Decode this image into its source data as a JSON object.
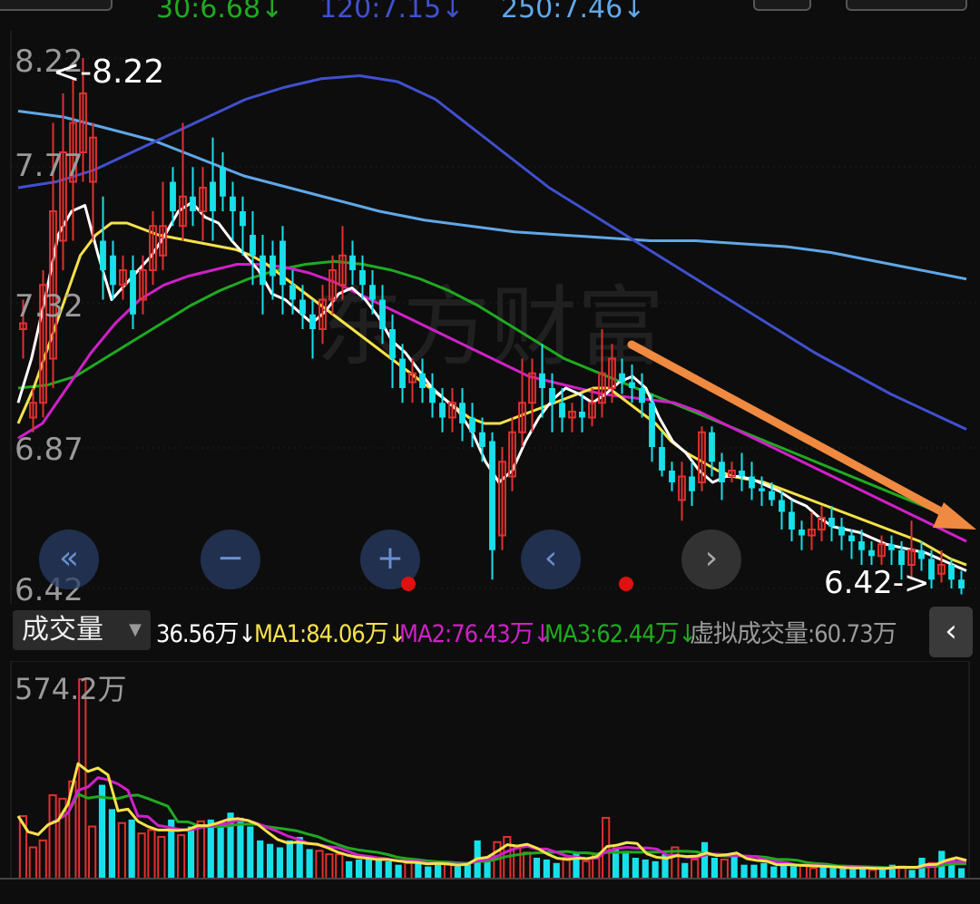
{
  "top_ma": [
    {
      "label": "30:6.68↓",
      "color": "#1faa1f"
    },
    {
      "label": "120:7.15↓",
      "color": "#4050d0"
    },
    {
      "label": "250:7.46↓",
      "color": "#60a8e8"
    }
  ],
  "price_axis": {
    "labels": [
      "8.22",
      "7.77",
      "7.32",
      "6.87",
      "6.42"
    ]
  },
  "annotations": {
    "high_marker": "<-8.22",
    "low_marker": "6.42->"
  },
  "watermark": "东方财富",
  "volume_header": {
    "selector_label": "成交量",
    "current": "36.56万↓",
    "ma1": "MA1:84.06万↓",
    "ma2": "MA2:76.43万↓",
    "ma3": "MA3:62.44万↓",
    "virtual": "虚拟成交量:60.73万"
  },
  "volume_axis": {
    "max_label": "574.2万"
  },
  "colors": {
    "up": "#e03030",
    "down": "#18e0ea",
    "ma5": "#ffffff",
    "ma10": "#f5e24a",
    "ma20": "#d020c8",
    "ma30": "#1faa1f",
    "ma120": "#4050d0",
    "ma250": "#60a8e8",
    "arrow": "#f08a40"
  },
  "nav_buttons": {
    "rewind": "«",
    "zoom_out": "−",
    "zoom_in": "+",
    "prev": "‹",
    "next": "›",
    "collapse": "‹"
  },
  "chart_data": {
    "type": "candlestick",
    "y_range": [
      6.42,
      8.22
    ],
    "candles": [
      [
        7.3,
        7.32,
        7.2,
        7.4
      ],
      [
        7.0,
        7.05,
        6.95,
        7.1
      ],
      [
        7.05,
        7.45,
        7.0,
        7.5
      ],
      [
        7.2,
        7.7,
        7.1,
        8.0
      ],
      [
        7.6,
        7.9,
        7.5,
        8.1
      ],
      [
        7.8,
        8.0,
        7.6,
        8.15
      ],
      [
        7.9,
        8.1,
        7.8,
        8.22
      ],
      [
        7.8,
        7.95,
        7.6,
        8.0
      ],
      [
        7.6,
        7.5,
        7.4,
        7.75
      ],
      [
        7.55,
        7.45,
        7.4,
        7.6
      ],
      [
        7.45,
        7.5,
        7.4,
        7.55
      ],
      [
        7.5,
        7.35,
        7.3,
        7.55
      ],
      [
        7.4,
        7.5,
        7.35,
        7.55
      ],
      [
        7.5,
        7.65,
        7.45,
        7.7
      ],
      [
        7.55,
        7.65,
        7.5,
        7.8
      ],
      [
        7.8,
        7.7,
        7.65,
        7.85
      ],
      [
        7.65,
        7.75,
        7.6,
        8.0
      ],
      [
        7.75,
        7.7,
        7.65,
        7.85
      ],
      [
        7.7,
        7.78,
        7.6,
        7.85
      ],
      [
        7.8,
        7.7,
        7.6,
        7.95
      ],
      [
        7.85,
        7.75,
        7.7,
        7.9
      ],
      [
        7.75,
        7.7,
        7.6,
        7.8
      ],
      [
        7.7,
        7.65,
        7.55,
        7.75
      ],
      [
        7.62,
        7.55,
        7.45,
        7.7
      ],
      [
        7.55,
        7.45,
        7.35,
        7.62
      ],
      [
        7.55,
        7.48,
        7.4,
        7.6
      ],
      [
        7.6,
        7.45,
        7.35,
        7.65
      ],
      [
        7.45,
        7.4,
        7.35,
        7.5
      ],
      [
        7.4,
        7.35,
        7.3,
        7.45
      ],
      [
        7.35,
        7.3,
        7.2,
        7.4
      ],
      [
        7.3,
        7.4,
        7.25,
        7.45
      ],
      [
        7.4,
        7.5,
        7.35,
        7.55
      ],
      [
        7.45,
        7.55,
        7.4,
        7.65
      ],
      [
        7.55,
        7.5,
        7.45,
        7.6
      ],
      [
        7.5,
        7.45,
        7.4,
        7.55
      ],
      [
        7.45,
        7.4,
        7.35,
        7.5
      ],
      [
        7.4,
        7.3,
        7.25,
        7.45
      ],
      [
        7.3,
        7.2,
        7.1,
        7.35
      ],
      [
        7.2,
        7.1,
        7.05,
        7.25
      ],
      [
        7.12,
        7.15,
        7.05,
        7.2
      ],
      [
        7.15,
        7.1,
        7.05,
        7.2
      ],
      [
        7.1,
        7.05,
        7.0,
        7.15
      ],
      [
        7.05,
        7.0,
        6.95,
        7.1
      ],
      [
        7.0,
        7.05,
        6.95,
        7.1
      ],
      [
        7.05,
        6.98,
        6.92,
        7.1
      ],
      [
        7.0,
        6.95,
        6.9,
        7.05
      ],
      [
        6.95,
        6.9,
        6.85,
        7.0
      ],
      [
        6.92,
        6.55,
        6.45,
        6.95
      ],
      [
        6.6,
        6.85,
        6.55,
        6.9
      ],
      [
        6.8,
        6.95,
        6.75,
        7.0
      ],
      [
        6.95,
        7.05,
        6.9,
        7.2
      ],
      [
        7.05,
        7.15,
        6.95,
        7.2
      ],
      [
        7.15,
        7.1,
        7.0,
        7.25
      ],
      [
        7.1,
        7.05,
        6.95,
        7.15
      ],
      [
        7.05,
        7.0,
        6.95,
        7.1
      ],
      [
        7.0,
        7.02,
        6.95,
        7.05
      ],
      [
        7.02,
        7.0,
        6.95,
        7.08
      ],
      [
        7.0,
        7.05,
        6.97,
        7.1
      ],
      [
        7.05,
        7.15,
        7.0,
        7.3
      ],
      [
        7.1,
        7.2,
        7.05,
        7.25
      ],
      [
        7.15,
        7.12,
        7.08,
        7.2
      ],
      [
        7.12,
        7.1,
        7.05,
        7.18
      ],
      [
        7.1,
        7.05,
        7.0,
        7.15
      ],
      [
        7.05,
        6.9,
        6.85,
        7.08
      ],
      [
        6.9,
        6.82,
        6.8,
        6.95
      ],
      [
        6.82,
        6.78,
        6.75,
        6.85
      ],
      [
        6.72,
        6.8,
        6.65,
        6.85
      ],
      [
        6.8,
        6.75,
        6.7,
        6.85
      ],
      [
        6.78,
        6.95,
        6.75,
        6.97
      ],
      [
        6.95,
        6.85,
        6.8,
        6.97
      ],
      [
        6.85,
        6.78,
        6.72,
        6.88
      ],
      [
        6.8,
        6.82,
        6.78,
        6.85
      ],
      [
        6.82,
        6.8,
        6.75,
        6.88
      ],
      [
        6.8,
        6.76,
        6.72,
        6.85
      ],
      [
        6.76,
        6.75,
        6.7,
        6.8
      ],
      [
        6.75,
        6.72,
        6.7,
        6.78
      ],
      [
        6.72,
        6.68,
        6.62,
        6.75
      ],
      [
        6.68,
        6.62,
        6.58,
        6.72
      ],
      [
        6.62,
        6.6,
        6.55,
        6.65
      ],
      [
        6.6,
        6.62,
        6.55,
        6.68
      ],
      [
        6.62,
        6.66,
        6.58,
        6.7
      ],
      [
        6.66,
        6.63,
        6.58,
        6.7
      ],
      [
        6.63,
        6.6,
        6.55,
        6.66
      ],
      [
        6.6,
        6.58,
        6.52,
        6.62
      ],
      [
        6.58,
        6.55,
        6.5,
        6.62
      ],
      [
        6.55,
        6.53,
        6.5,
        6.58
      ],
      [
        6.53,
        6.57,
        6.5,
        6.6
      ],
      [
        6.57,
        6.55,
        6.5,
        6.6
      ],
      [
        6.55,
        6.5,
        6.45,
        6.58
      ],
      [
        6.5,
        6.55,
        6.45,
        6.65
      ],
      [
        6.55,
        6.52,
        6.48,
        6.58
      ],
      [
        6.52,
        6.45,
        6.42,
        6.55
      ],
      [
        6.47,
        6.5,
        6.44,
        6.55
      ],
      [
        6.5,
        6.45,
        6.42,
        6.52
      ],
      [
        6.45,
        6.42,
        6.4,
        6.48
      ]
    ],
    "ma5": [
      7.05,
      7.2,
      7.4,
      7.62,
      7.7,
      7.72,
      7.55,
      7.4,
      7.45,
      7.5,
      7.55,
      7.62,
      7.7,
      7.73,
      7.68,
      7.66,
      7.6,
      7.55,
      7.5,
      7.42,
      7.4,
      7.36,
      7.32,
      7.36,
      7.42,
      7.44,
      7.4,
      7.34,
      7.26,
      7.22,
      7.16,
      7.1,
      7.06,
      7.02,
      6.95,
      6.85,
      6.78,
      6.82,
      6.92,
      7.0,
      7.06,
      7.1,
      7.08,
      7.05,
      7.08,
      7.12,
      7.14,
      7.1,
      7.0,
      6.92,
      6.88,
      6.82,
      6.78,
      6.8,
      6.8,
      6.79,
      6.77,
      6.75,
      6.72,
      6.7,
      6.66,
      6.63,
      6.62,
      6.61,
      6.59,
      6.57,
      6.56,
      6.55,
      6.54,
      6.52,
      6.5,
      6.48
    ],
    "ma10": [
      6.98,
      7.1,
      7.25,
      7.4,
      7.55,
      7.62,
      7.66,
      7.66,
      7.64,
      7.62,
      7.61,
      7.6,
      7.59,
      7.58,
      7.57,
      7.55,
      7.52,
      7.48,
      7.44,
      7.4,
      7.36,
      7.32,
      7.28,
      7.24,
      7.2,
      7.16,
      7.12,
      7.08,
      7.04,
      7.0,
      6.98,
      6.98,
      7.0,
      7.02,
      7.04,
      7.06,
      7.08,
      7.1,
      7.1,
      7.06,
      7.02,
      6.98,
      6.92,
      6.88,
      6.85,
      6.82,
      6.8,
      6.79,
      6.78,
      6.76,
      6.74,
      6.72,
      6.7,
      6.68,
      6.66,
      6.64,
      6.62,
      6.6,
      6.58,
      6.55,
      6.52,
      6.5
    ],
    "ma20": [
      6.93,
      6.98,
      7.1,
      7.22,
      7.32,
      7.4,
      7.45,
      7.48,
      7.5,
      7.52,
      7.52,
      7.51,
      7.49,
      7.46,
      7.42,
      7.38,
      7.34,
      7.3,
      7.26,
      7.22,
      7.18,
      7.14,
      7.12,
      7.1,
      7.08,
      7.07,
      7.06,
      7.05,
      7.02,
      6.98,
      6.94,
      6.9,
      6.86,
      6.82,
      6.78,
      6.74,
      6.7,
      6.66,
      6.62,
      6.58
    ],
    "ma30": [
      7.1,
      7.11,
      7.14,
      7.2,
      7.26,
      7.32,
      7.38,
      7.43,
      7.47,
      7.5,
      7.52,
      7.53,
      7.52,
      7.5,
      7.47,
      7.43,
      7.38,
      7.32,
      7.26,
      7.2,
      7.16,
      7.12,
      7.08,
      7.04,
      7.0,
      6.96,
      6.92,
      6.88,
      6.84,
      6.8,
      6.76,
      6.72,
      6.68,
      6.64
    ],
    "ma120": [
      7.78,
      7.8,
      7.84,
      7.9,
      7.96,
      8.02,
      8.08,
      8.12,
      8.15,
      8.16,
      8.14,
      8.08,
      7.98,
      7.88,
      7.78,
      7.7,
      7.62,
      7.54,
      7.46,
      7.38,
      7.3,
      7.22,
      7.15,
      7.08,
      7.02,
      6.96
    ],
    "ma250": [
      8.04,
      8.02,
      7.98,
      7.94,
      7.88,
      7.82,
      7.78,
      7.74,
      7.7,
      7.67,
      7.65,
      7.63,
      7.62,
      7.61,
      7.6,
      7.6,
      7.59,
      7.58,
      7.56,
      7.53,
      7.5,
      7.47
    ],
    "volume_max": 574.2,
    "volumes": [
      180,
      90,
      110,
      240,
      230,
      280,
      574,
      150,
      270,
      200,
      160,
      170,
      130,
      140,
      120,
      170,
      125,
      150,
      165,
      170,
      155,
      190,
      175,
      150,
      110,
      100,
      90,
      110,
      120,
      85,
      80,
      70,
      70,
      50,
      55,
      60,
      55,
      50,
      40,
      45,
      50,
      35,
      45,
      40,
      35,
      45,
      110,
      55,
      105,
      120,
      95,
      75,
      60,
      55,
      45,
      60,
      75,
      50,
      70,
      175,
      90,
      80,
      60,
      55,
      50,
      70,
      90,
      45,
      55,
      105,
      60,
      55,
      75,
      40,
      40,
      45,
      35,
      40,
      35,
      40,
      30,
      35,
      30,
      30,
      28,
      35,
      25,
      30,
      40,
      35,
      25,
      60,
      45,
      80,
      55,
      30
    ]
  }
}
